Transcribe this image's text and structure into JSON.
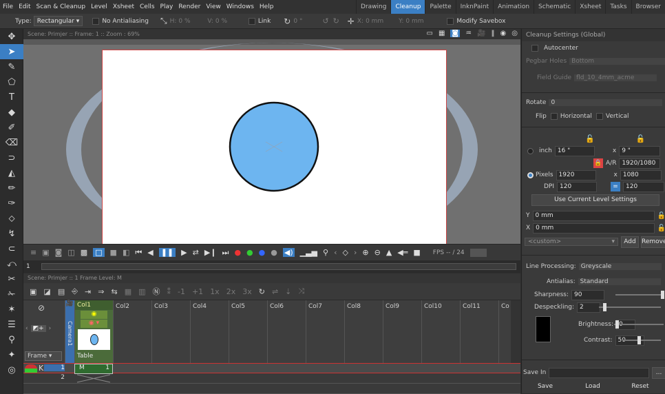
{
  "menu": [
    "File",
    "Edit",
    "Scan & Cleanup",
    "Level",
    "Xsheet",
    "Cells",
    "Play",
    "Render",
    "View",
    "Windows",
    "Help"
  ],
  "rooms": [
    "Drawing",
    "Cleanup",
    "Palette",
    "InknPaint",
    "Animation",
    "Schematic",
    "Xsheet",
    "Tasks",
    "Browser"
  ],
  "active_room": "Cleanup",
  "tooloptions": {
    "type_label": "Type:",
    "type_value": "Rectangular",
    "no_antialiasing": "No Antialiasing",
    "h": "H:",
    "h_val": "0 %",
    "v": "V:",
    "v_val": "0 %",
    "link": "Link",
    "rot": "0 °",
    "x": "X:",
    "x_val": "0 mm",
    "y": "Y:",
    "y_val": "0 mm",
    "modify_savebox": "Modify Savebox"
  },
  "viewer": {
    "header": "Scene: Primjer  ::  Frame: 1  ::  Zoom : 69%"
  },
  "flipbar": {
    "fps_label": "FPS -- / 24",
    "frame": "1"
  },
  "xsheet": {
    "header": "Scene: Primjer  ::  1 Frame  Level: M",
    "columns": [
      "Col1",
      "Col2",
      "Col3",
      "Col4",
      "Col5",
      "Col6",
      "Col7",
      "Col8",
      "Col9",
      "Col10",
      "Col11",
      "Co"
    ],
    "camera_label": "Camera1",
    "table_label": "Table",
    "frame_label": "Frame",
    "rows": [
      "1",
      "2"
    ],
    "cell_value": "M",
    "cell_frame": "1"
  },
  "cleanup": {
    "title": "Cleanup Settings (Global)",
    "autocenter": "Autocenter",
    "pegbar_holes_label": "Pegbar Holes",
    "pegbar_holes_value": "Bottom",
    "field_guide_label": "Field Guide",
    "field_guide_value": "fld_10_4mm_acme",
    "rotate_label": "Rotate",
    "rotate_value": "0",
    "flip_label": "Flip",
    "horizontal": "Horizontal",
    "vertical": "Vertical",
    "inch_label": "inch",
    "inch_w": "16 \"",
    "inch_h": "9 \"",
    "ar_label": "A/R",
    "ar_value": "1920/1080",
    "pixels_label": "Pixels",
    "px_w": "1920",
    "px_h": "1080",
    "dpi_label": "DPI",
    "dpi_value": "120",
    "dpi_value2": "120",
    "use_current": "Use Current Level Settings",
    "y_offset": "0 mm",
    "x_offset": "0 mm",
    "preset": "<custom>",
    "add": "Add",
    "remove": "Remove",
    "line_processing_label": "Line Processing:",
    "line_processing_value": "Greyscale",
    "antialias_label": "Antialias:",
    "antialias_value": "Standard",
    "sharpness_label": "Sharpness:",
    "sharpness_value": "90",
    "despeckling_label": "Despeckling:",
    "despeckling_value": "2",
    "brightness_label": "Brightness:",
    "brightness_value": "0",
    "contrast_label": "Contrast:",
    "contrast_value": "50",
    "save_in": "Save In",
    "browse": "...",
    "save": "Save",
    "load": "Load",
    "reset": "Reset",
    "x_label": "X",
    "y_label": "Y",
    "x_sep": "x"
  },
  "colors": {
    "accent": "#3b7fc4",
    "ball_fill": "#6db5f0",
    "ring": "#97a4b4",
    "cell_green": "#2f7a2f"
  }
}
